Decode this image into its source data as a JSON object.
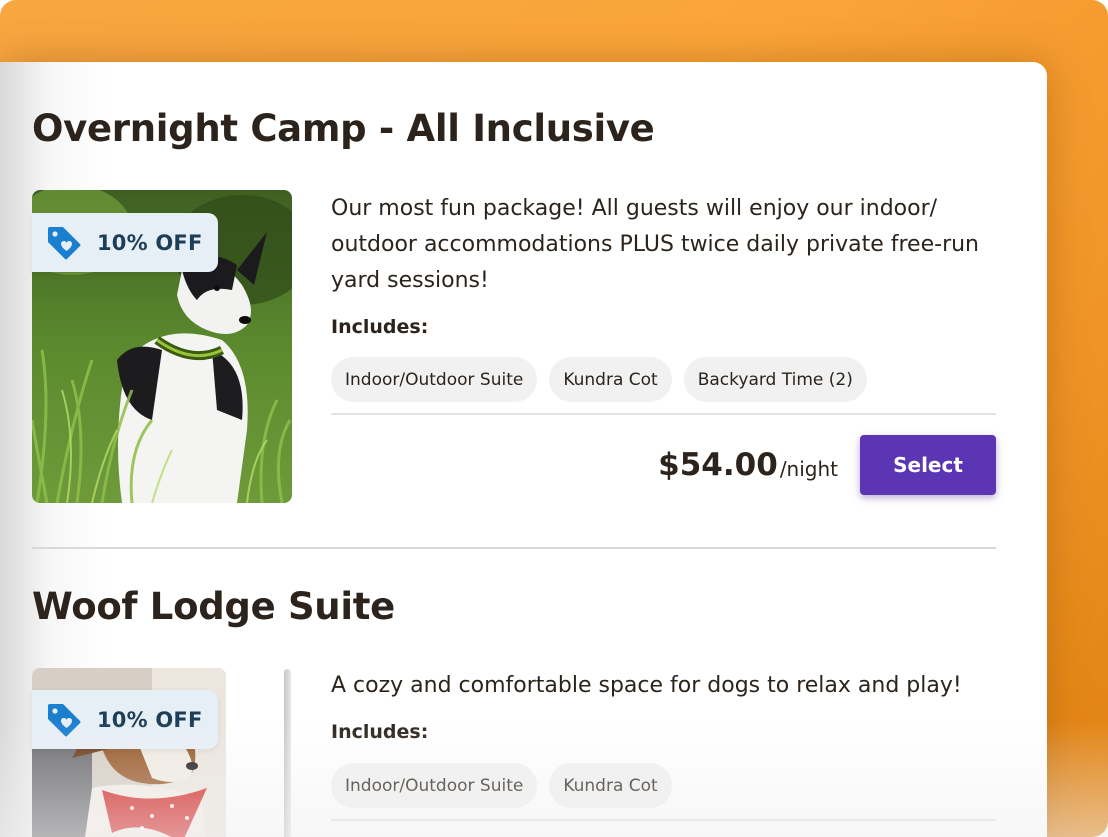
{
  "colors": {
    "background": "#fba539",
    "card": "#ffffff",
    "text": "#2c241c",
    "accent_button": "#5b35b4",
    "badge_bg": "#e7eff6",
    "badge_text": "#1d3e57",
    "tag_icon": "#1b7fd0",
    "chip_bg": "#f1f1f1"
  },
  "packages": [
    {
      "title": "Overnight Camp - All Inclusive",
      "photo_icon": "dog-photo-border-collie",
      "discount": {
        "icon": "price-tag-heart-icon",
        "label": "10% OFF"
      },
      "description": "Our most fun package! All guests will enjoy our indoor/ outdoor accommodations PLUS twice daily private free-run yard sessions!",
      "includes_label": "Includes:",
      "amenities": [
        "Indoor/Outdoor Suite",
        "Kundra Cot",
        "Backyard Time (2)"
      ],
      "price": "$54.00",
      "price_unit": "/night",
      "action_label": "Select"
    },
    {
      "title": "Woof Lodge Suite",
      "photo_icon": "dog-photo-bandana",
      "discount": {
        "icon": "price-tag-heart-icon",
        "label": "10% OFF"
      },
      "description": "A cozy and comfortable space for dogs to relax and play!",
      "includes_label": "Includes:",
      "amenities": [
        "Indoor/Outdoor Suite",
        "Kundra Cot"
      ]
    }
  ]
}
